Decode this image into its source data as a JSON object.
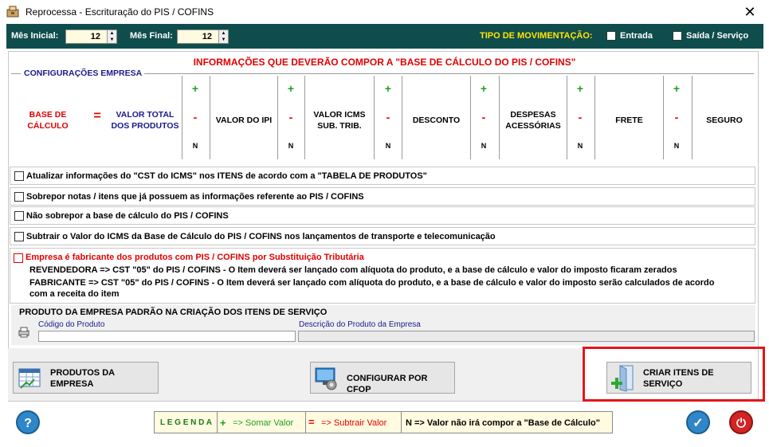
{
  "window": {
    "title": "Reprocessa - Escrituração do PIS / COFINS"
  },
  "header": {
    "mes_inicial_label": "Mês Inicial:",
    "mes_inicial_value": "12",
    "mes_final_label": "Mês Final:",
    "mes_final_value": "12",
    "tipo_label": "TIPO DE MOVIMENTAÇÃO:",
    "entrada_label": "Entrada",
    "saida_label": "Saída / Serviço"
  },
  "panel": {
    "title": "INFORMAÇÕES QUE DEVERÃO COMPOR A \"BASE DE CÁLCULO DO PIS / COFINS\"",
    "config_label": "CONFIGURAÇÕES EMPRESA",
    "base_line1": "BASE DE",
    "base_line2": "CÁLCULO",
    "equals": "=",
    "valor_total_line1": "VALOR TOTAL",
    "valor_total_line2": "DOS PRODUTOS",
    "plus": "+",
    "minus": "-",
    "n": "N",
    "col_ipi": "VALOR DO IPI",
    "col_icms_line1": "VALOR ICMS",
    "col_icms_line2": "SUB. TRIB.",
    "col_desconto": "DESCONTO",
    "col_despesas_line1": "DESPESAS",
    "col_despesas_line2": "ACESSÓRIAS",
    "col_frete": "FRETE",
    "col_seguro": "SEGURO"
  },
  "options": {
    "opt1": "Atualizar informações do \"CST do ICMS\" nos ITENS de acordo com a \"TABELA DE PRODUTOS\"",
    "opt2": "Sobrepor notas / itens que já possuem as informações referente ao PIS / COFINS",
    "opt3": "Não sobrepor a base de cálculo do PIS / COFINS",
    "opt4": "Subtrair o Valor do ICMS da Base de Cálculo do PIS / COFINS nos lançamentos de transporte e telecomunicação",
    "opt5": "Empresa é fabricante dos produtos com PIS / COFINS por Substituição Tributária",
    "revendedora": "REVENDEDORA => CST \"05\" do PIS / COFINS - O Item deverá ser lançado com alíquota do produto, e a base de cálculo e valor do imposto ficaram zerados",
    "fabricante_line1": "FABRICANTE   => CST \"05\" do PIS / COFINS - O Item deverá ser lançado com alíquota do produto, e a base de cálculo e valor do imposto serão calculados de acordo",
    "fabricante_line2": "com a receita do item"
  },
  "produto": {
    "section_label": "PRODUTO DA EMPRESA PADRÃO NA CRIAÇÃO DOS ITENS DE SERVIÇO",
    "codigo_label": "Código do Produto",
    "codigo_value": "",
    "descricao_label": "Descrição do Produto da Empresa",
    "descricao_value": ""
  },
  "buttons": {
    "produtos_line1": "PRODUTOS DA",
    "produtos_line2": "EMPRESA",
    "cfop": "CONFIGURAR POR CFOP",
    "criar_line1": "CRIAR ITENS DE",
    "criar_line2": "SERVIÇO"
  },
  "legend": {
    "title": "L E G E N D A",
    "somar_sign": "+",
    "somar": "=> Somar Valor",
    "subtrair_sign": "=",
    "subtrair": "=> Subtrair Valor",
    "nao_compor": "N => Valor não irá compor a \"Base de Cálculo\""
  },
  "footer": {
    "help": "?",
    "ok": "✓",
    "power": "⏻"
  },
  "colors": {
    "header_bg": "#0f4d4d",
    "accent_red": "#e00000",
    "accent_green": "#1fa01f",
    "navy": "#1a1a8c",
    "highlight_frame": "#e3151a"
  }
}
